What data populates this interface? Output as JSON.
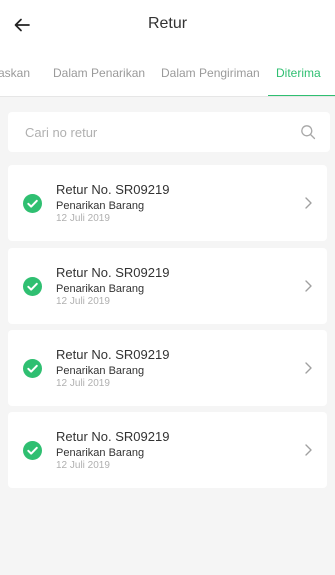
{
  "header": {
    "title": "Retur",
    "back_icon": "arrow-left-icon"
  },
  "tabs": [
    {
      "label": "Diproses/Ditolak Kaskan",
      "visible_text": "askan",
      "active": false
    },
    {
      "label": "Dalam Penarikan",
      "active": false
    },
    {
      "label": "Dalam Pengiriman",
      "active": false
    },
    {
      "label": "Diterima",
      "active": true
    }
  ],
  "search": {
    "placeholder": "Cari no retur",
    "value": "",
    "icon": "search-icon"
  },
  "returns": [
    {
      "title": "Retur No. SR09219",
      "status": "Penarikan Barang",
      "date": "12 Juli 2019"
    },
    {
      "title": "Retur No. SR09219",
      "status": "Penarikan Barang",
      "date": "12 Juli 2019"
    },
    {
      "title": "Retur No. SR09219",
      "status": "Penarikan Barang",
      "date": "12 Juli 2019"
    },
    {
      "title": "Retur No. SR09219",
      "status": "Penarikan Barang",
      "date": "12 Juli 2019"
    }
  ],
  "colors": {
    "accent": "#2fbf71",
    "background": "#f5f5f5",
    "card": "#ffffff",
    "muted_text": "#9a9a9a"
  }
}
